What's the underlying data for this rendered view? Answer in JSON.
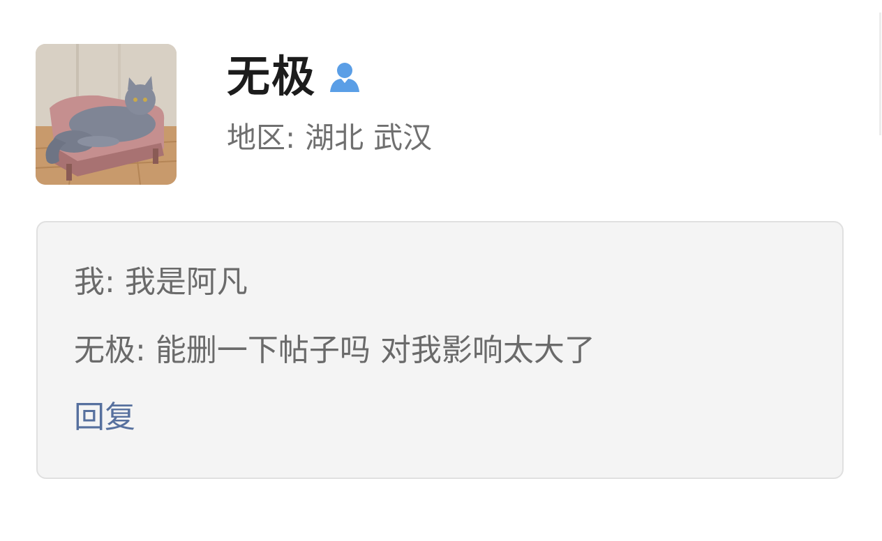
{
  "profile": {
    "name": "无极",
    "verify_icon": "user-verified-icon",
    "region_label": "地区:",
    "region_province": "湖北",
    "region_city": "武汉",
    "avatar_icon": "cat-on-sofa-avatar"
  },
  "messages": [
    {
      "sender": "我:",
      "text": "我是阿凡"
    },
    {
      "sender": "无极:",
      "text": "能删一下帖子吗 对我影响太大了"
    }
  ],
  "actions": {
    "reply_label": "回复"
  },
  "colors": {
    "name": "#1c1c1c",
    "secondary_text": "#6f6f6f",
    "reply_link": "#56709e",
    "verify_icon": "#5a9ee6",
    "box_background": "#f4f4f4",
    "box_border": "#e0e0e0"
  }
}
